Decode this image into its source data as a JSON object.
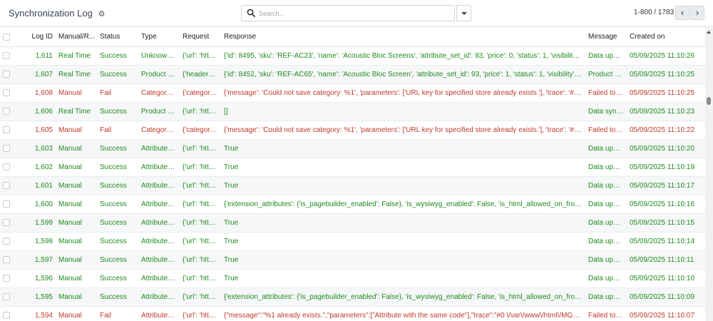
{
  "header": {
    "title": "Synchronization Log",
    "search_placeholder": "Search...",
    "pager_text": "1-800 / 1783",
    "prev_label": "‹",
    "next_label": "›"
  },
  "columns": [
    "Log ID",
    "Manual/R...",
    "Status",
    "Type",
    "Request",
    "Response",
    "Message",
    "Created on"
  ],
  "rows": [
    {
      "id": "1,611",
      "mode": "Real Time",
      "status": "Success",
      "type": "Unknown ...",
      "request": "{'url': 'https...",
      "response": "{'id': 8495, 'sku': 'REF-AC23', 'name': 'Acoustic Bloc Screens', 'attribute_set_id': 93, 'price': 0, 'status': 1, 'visibility': 4, 'type_id': '...",
      "message": "Data updat...",
      "created": "05/09/2025 11:10:26",
      "cls": "ok"
    },
    {
      "id": "1,607",
      "mode": "Real Time",
      "status": "Success",
      "type": "Product Sy...",
      "request": "{'headers': ...",
      "response": "{'id': 8452, 'sku': 'REF-AC65', 'name': 'Acoustic Bloc Screen', 'attribute_set_id': 93, 'price': 1, 'status': 1, 'visibility': 4, 'type_id': 's...",
      "message": "Product U...",
      "created": "05/09/2025 11:10:25",
      "cls": "ok"
    },
    {
      "id": "1,608",
      "mode": "Manual",
      "status": "Fail",
      "type": "Category S...",
      "request": "{'category_...",
      "response": "{'message': 'Could not save category: %1', 'parameters': ['URL key for specified store already exists.'], 'trace': '#0 /var/www/h...",
      "message": "Failed to sy...",
      "created": "05/09/2025 11:10:25",
      "cls": "fail"
    },
    {
      "id": "1,606",
      "mode": "Real Time",
      "status": "Success",
      "type": "Product Q...",
      "request": "{'url': 'https...",
      "response": "[]",
      "message": "Data synce...",
      "created": "05/09/2025 11:10:23",
      "cls": "ok"
    },
    {
      "id": "1,605",
      "mode": "Manual",
      "status": "Fail",
      "type": "Category S...",
      "request": "{'category_...",
      "response": "{'message': 'Could not save category: %1', 'parameters': ['URL key for specified store already exists.'], 'trace': '#0 /var/www/h...",
      "message": "Failed to sy...",
      "created": "05/09/2025 11:10:22",
      "cls": "fail"
    },
    {
      "id": "1,603",
      "mode": "Manual",
      "status": "Success",
      "type": "Attribute V...",
      "request": "{'url': 'https...",
      "response": "True",
      "message": "Data updat...",
      "created": "05/09/2025 11:10:20",
      "cls": "ok"
    },
    {
      "id": "1,602",
      "mode": "Manual",
      "status": "Success",
      "type": "Attribute V...",
      "request": "{'url': 'https...",
      "response": "True",
      "message": "Data updat...",
      "created": "05/09/2025 11:10:19",
      "cls": "ok"
    },
    {
      "id": "1,601",
      "mode": "Manual",
      "status": "Success",
      "type": "Attribute V...",
      "request": "{'url': 'https...",
      "response": "True",
      "message": "Data updat...",
      "created": "05/09/2025 11:10:17",
      "cls": "ok"
    },
    {
      "id": "1,600",
      "mode": "Manual",
      "status": "Success",
      "type": "Attribute S...",
      "request": "{'url': 'https...",
      "response": "{'extension_attributes': {'is_pagebuilder_enabled': False}, 'is_wysiwyg_enabled': False, 'is_html_allowed_on_front': True, 'used_...",
      "message": "Data updat...",
      "created": "05/09/2025 11:10:16",
      "cls": "ok"
    },
    {
      "id": "1,599",
      "mode": "Manual",
      "status": "Success",
      "type": "Attribute V...",
      "request": "{'url': 'https...",
      "response": "True",
      "message": "Data updat...",
      "created": "05/09/2025 11:10:15",
      "cls": "ok"
    },
    {
      "id": "1,598",
      "mode": "Manual",
      "status": "Success",
      "type": "Attribute V...",
      "request": "{'url': 'https...",
      "response": "True",
      "message": "Data updat...",
      "created": "05/09/2025 11:10:14",
      "cls": "ok"
    },
    {
      "id": "1,597",
      "mode": "Manual",
      "status": "Success",
      "type": "Attribute V...",
      "request": "{'url': 'https...",
      "response": "True",
      "message": "Data updat...",
      "created": "05/09/2025 11:10:11",
      "cls": "ok"
    },
    {
      "id": "1,596",
      "mode": "Manual",
      "status": "Success",
      "type": "Attribute V...",
      "request": "{'url': 'https...",
      "response": "True",
      "message": "Data updat...",
      "created": "05/09/2025 11:10:10",
      "cls": "ok"
    },
    {
      "id": "1,595",
      "mode": "Manual",
      "status": "Success",
      "type": "Attribute S...",
      "request": "{'url': 'https...",
      "response": "{'extension_attributes': {'is_pagebuilder_enabled': False}, 'is_wysiwyg_enabled': False, 'is_html_allowed_on_front': True, 'used_...",
      "message": "Data updat...",
      "created": "05/09/2025 11:10:09",
      "cls": "ok"
    },
    {
      "id": "1,594",
      "mode": "Manual",
      "status": "Fail",
      "type": "Attribute S...",
      "request": "{'url': 'https...",
      "response": "{\"message\":\"%1 already exists.\",\"parameters\":[\"Attribute with the same code\"],\"trace\":\"#0 \\/var\\/www\\/html\\/MGEN_59\\/ve...",
      "message": "Failed to sy...",
      "created": "05/09/2025 11:10:07",
      "cls": "fail"
    }
  ],
  "colors": {
    "success": "#1f8a1f",
    "fail": "#c0392b",
    "stripe": "#f6f7f8"
  },
  "icons": {
    "settings": "gear-icon",
    "search": "search-icon",
    "dropdown": "caret-down-icon"
  }
}
